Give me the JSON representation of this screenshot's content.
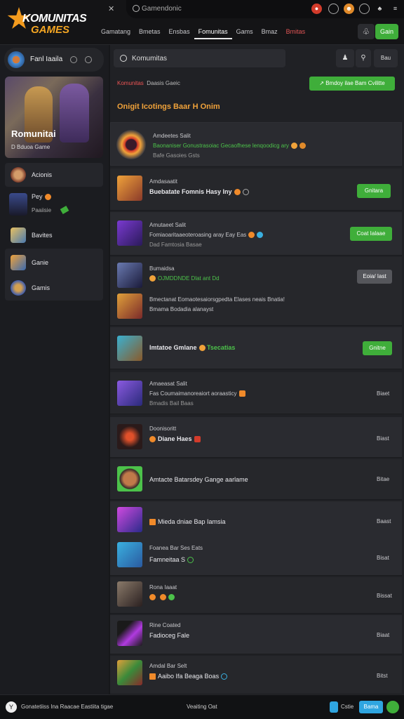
{
  "app": {
    "logo_line1": "KOMUNITAS",
    "logo_line2": "GAMES",
    "top_search": "Gamendonic"
  },
  "nav": [
    "Gamatang",
    "Bmetas",
    "Ensbas",
    "Fomunitas",
    "Gams",
    "Bmaz",
    "Bmitas"
  ],
  "join_label": "Gain",
  "profile": {
    "name": "Fanl Iaaila"
  },
  "hero": {
    "title": "Romunitai",
    "subtitle": "D Bduoa Game"
  },
  "sidebar": [
    {
      "label": "Acionis"
    },
    {
      "label": "Pey",
      "sub": "Paaiisie"
    },
    {
      "label": "Bavites"
    },
    {
      "label": "Ganie"
    },
    {
      "label": "Gamis"
    }
  ],
  "search": {
    "value": "Komumitas"
  },
  "search_button": "Bau",
  "crumb": {
    "red": "Komunitas",
    "rest": "Daasis Gaeic"
  },
  "follow_label": "Bmdoy ilae Bam Cvilitte",
  "section_title": "Onigit Icotings Baar H Onim",
  "featured": {
    "title": "Amdeetes Salit",
    "line": "Baonaniser Gonustrasoiac Gecaofhese lenqoodicg ary",
    "meta": "Bafe Gasoies Gsts"
  },
  "rows": [
    {
      "title": "Amdasaatit",
      "line": "Buebatate Fomnis Hasy Iny",
      "button": "Gnitara"
    },
    {
      "title": "Amutaeet Salit",
      "line": "Fomiaoaritaaeoteroasing aray Eay Eas",
      "meta": "Dad Famtosia Basae",
      "button": "Coat Ialaae"
    },
    {
      "title": "Bumaidsa",
      "line": "OJMDDNDE Dlat ant Dd",
      "button": "Eoia/ Iast",
      "sub_line1": "Bmectanat Eomaotesaiorsgpedta Elases neais Bnatia!",
      "sub_line2": "Bmama Bodadia alanayst"
    },
    {
      "title": "Imtatoe Gmlane",
      "line": "Tsecatias",
      "button": "Gnitne"
    },
    {
      "title": "Amaeasat Salit",
      "line": "Fas Coumaimanoreaiort aoraasticy",
      "meta": "Bmadis Bail Baas",
      "count": "Biaet"
    },
    {
      "title": "Doonisoritt",
      "line": "Diane Haes",
      "count": "Biast"
    },
    {
      "title": "Amtacte Batarsdey Gange aarlame",
      "count": "Bitae"
    },
    {
      "title": "Mieda dniae Bap Iamsia",
      "count": "Baast",
      "sub_title": "Foanea Bar Ses Eats",
      "sub_line": "Famneitaa S",
      "sub_count": "Bisat"
    },
    {
      "title": "Rona Iaaat",
      "count": "Bissat"
    },
    {
      "title": "Rine Coated",
      "line": "Fadioceg Fale",
      "count": "Biaat"
    },
    {
      "title": "Amdal Bar Selt",
      "line": "Aaibo Ifa Beaga Boas",
      "count": "Bitst"
    }
  ],
  "footer": {
    "left": "Gonatetiiss Ina Raacae Eastiita tigae",
    "center": "Veaiting Oat",
    "right_label": "Cstie",
    "button": "Bama"
  }
}
